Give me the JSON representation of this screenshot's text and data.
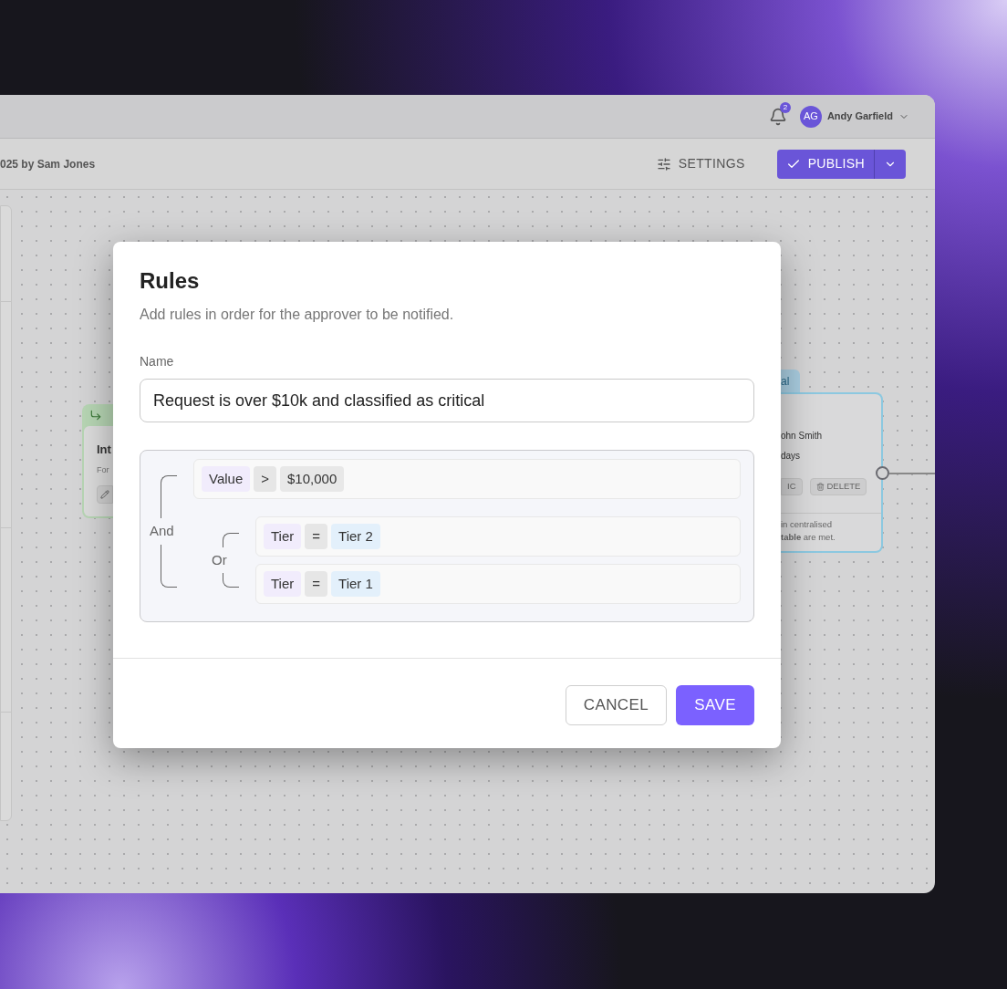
{
  "header": {
    "notifications": "2",
    "user": {
      "initials": "AG",
      "name": "Andy Garfield"
    }
  },
  "toolbar": {
    "subtitle": "025 by Sam Jones",
    "settings": "SETTINGS",
    "publish": "PUBLISH"
  },
  "canvas": {
    "left_node": {
      "title": "Int",
      "text": "For"
    },
    "right_node": {
      "tag": "al",
      "lines": [
        "ohn Smith",
        "days"
      ],
      "buttons": [
        "IC",
        "DELETE"
      ],
      "note": [
        "in centralised",
        "**table** are met."
      ]
    }
  },
  "dialog": {
    "title": "Rules",
    "description": "Add rules in order for the approver to be notified.",
    "name_label": "Name",
    "name_value": "Request is over $10k and classified as critical",
    "rules": {
      "kind": "group",
      "operator": "And",
      "children": [
        {
          "kind": "condition",
          "field": "Value",
          "op": ">",
          "value": "$10,000",
          "color": "#e8e8e8"
        },
        {
          "kind": "group",
          "operator": "Or",
          "children": [
            {
              "kind": "condition",
              "field": "Tier",
              "op": "=",
              "value": "Tier 2",
              "color": "#e3f0fb"
            },
            {
              "kind": "condition",
              "field": "Tier",
              "op": "=",
              "value": "Tier 1",
              "color": "#e3f0fb"
            }
          ]
        }
      ]
    },
    "buttons": {
      "cancel": "CANCEL",
      "save": "SAVE"
    }
  }
}
